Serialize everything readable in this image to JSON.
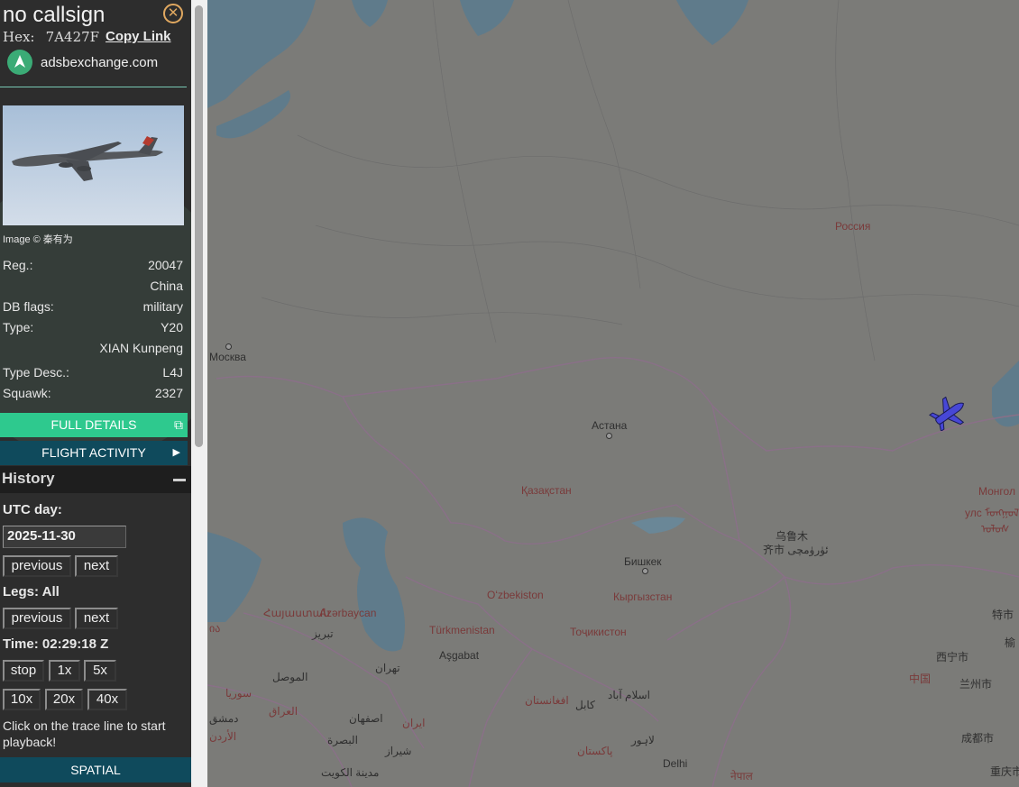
{
  "aircraft": {
    "callsign": "no callsign",
    "hex_label": "Hex:",
    "hex": "7A427F",
    "copy_link": "Copy Link",
    "source": "adsbexchange.com",
    "image_caption": "Image © 秦有为"
  },
  "details": [
    {
      "key": "Reg.:",
      "value": "20047"
    },
    {
      "key": "",
      "value": "China"
    },
    {
      "key": "DB flags:",
      "value": "military"
    },
    {
      "key": "Type:",
      "value": "Y20"
    },
    {
      "key": "",
      "value": "XIAN Kunpeng"
    },
    {
      "key": "Type Desc.:",
      "value": "L4J"
    },
    {
      "key": "Squawk:",
      "value": "2327"
    }
  ],
  "buttons": {
    "full_details": "FULL DETAILS",
    "flight_activity": "FLIGHT ACTIVITY",
    "spatial": "SPATIAL"
  },
  "history": {
    "title": "History",
    "utc_day_label": "UTC day:",
    "date": "2025-11-30",
    "previous": "previous",
    "next": "next",
    "legs_label": "Legs: All",
    "time_label": "Time: 02:29:18 Z",
    "speeds": [
      "stop",
      "1x",
      "5x",
      "10x",
      "20x",
      "40x"
    ],
    "hint": "Click on the trace line to start playback!"
  },
  "map_labels": {
    "russia": "Россия",
    "moscow": "Москва",
    "astana": "Астана",
    "kazakhstan": "Қазақстан",
    "urumqi_1": "乌鲁木",
    "urumqi_2": "齐市 ئۈرۈمچى",
    "bishkek": "Бишкек",
    "kyrgyzstan": "Кыргызстан",
    "uzbekistan": "Oʻzbekiston",
    "turkmenistan": "Türkmenistan",
    "ashgabat": "Aşgabat",
    "tajikistan": "Тоҷикистон",
    "mongolia_1": "Монгол",
    "mongolia_2": "улс ᠮᠣᠩᠭᠣᠯ",
    "mongolia_3": "ᠤᠯᠤᠰ",
    "azerbaijan": "Azərbaycan",
    "armenia": "Հայաստան",
    "georgia": "ია",
    "tabriz": "تبریز",
    "tehran": "تهران",
    "iran": "ایران",
    "isfahan": "اصفهان",
    "shiraz": "شیراز",
    "mosul": "الموصل",
    "iraq": "العراق",
    "basra": "البصرة",
    "kuwait": "مدينة الكويت",
    "syria": "سوريا",
    "damascus": "دمشق",
    "jordan": "الأردن",
    "afghanistan": "افغانستان",
    "kabul": "کابل",
    "islamabad": "اسلام آباد",
    "pakistan": "پاکستان",
    "lahore": "لاہور",
    "delhi": "Delhi",
    "nepal": "नेपाल",
    "china": "中国",
    "xining": "西宁市",
    "lanzhou": "兰州市",
    "chengdu": "成都市",
    "chongqing": "重庆市",
    "tete": "特市",
    "yu": "榆"
  },
  "colors": {
    "accent_green": "#2ec98e",
    "dark_teal": "#0f4a5c",
    "map_land": "#7b7b78",
    "water": "#5b7a8c",
    "aircraft": "#4747d6"
  }
}
